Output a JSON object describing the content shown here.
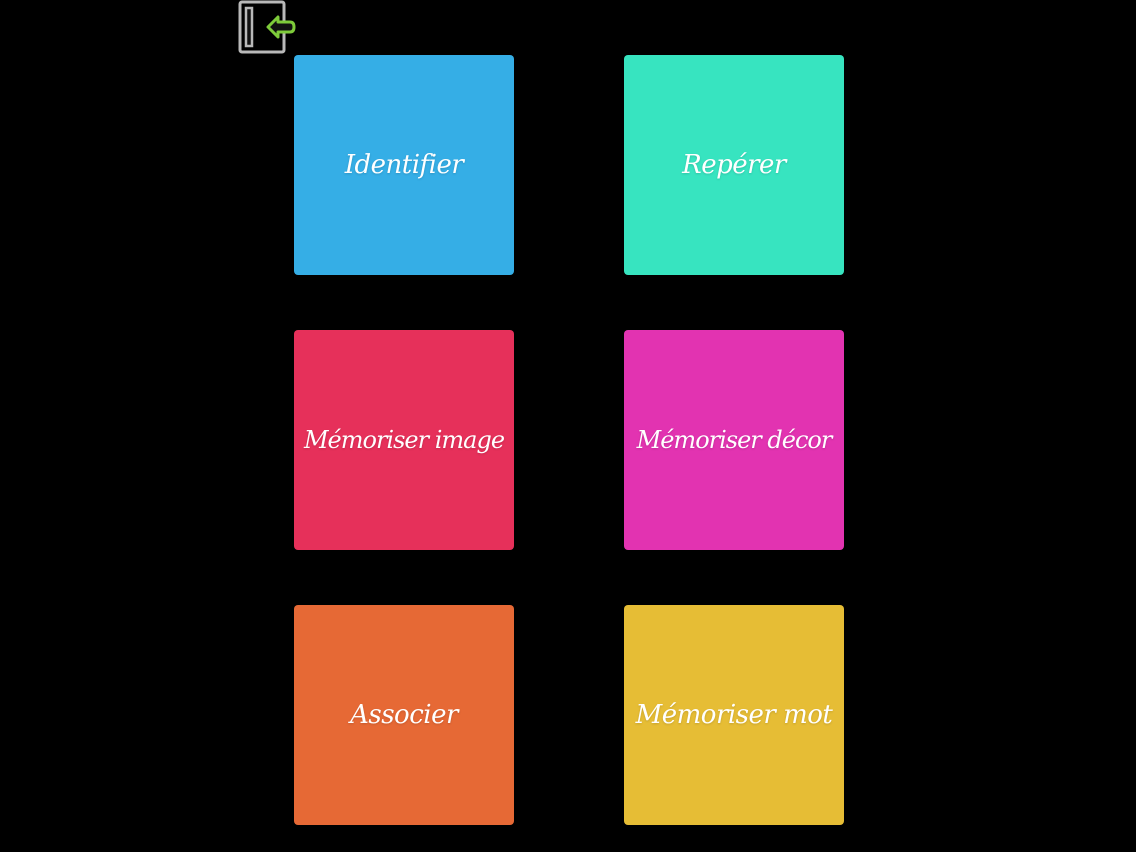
{
  "colors": {
    "background": "#000000",
    "exit_icon_frame": "#b9b9b9",
    "exit_icon_arrow": "#7ecb3a"
  },
  "exit": {
    "icon": "exit-door-arrow-icon"
  },
  "tiles": [
    {
      "label": "Identifier",
      "color": "#35aee6"
    },
    {
      "label": "Repérer",
      "color": "#37e4c0"
    },
    {
      "label": "Mémoriser image",
      "color": "#e6305a"
    },
    {
      "label": "Mémoriser décor",
      "color": "#e233b1"
    },
    {
      "label": "Associer",
      "color": "#e66935"
    },
    {
      "label": "Mémoriser mot",
      "color": "#e6bd35"
    }
  ]
}
